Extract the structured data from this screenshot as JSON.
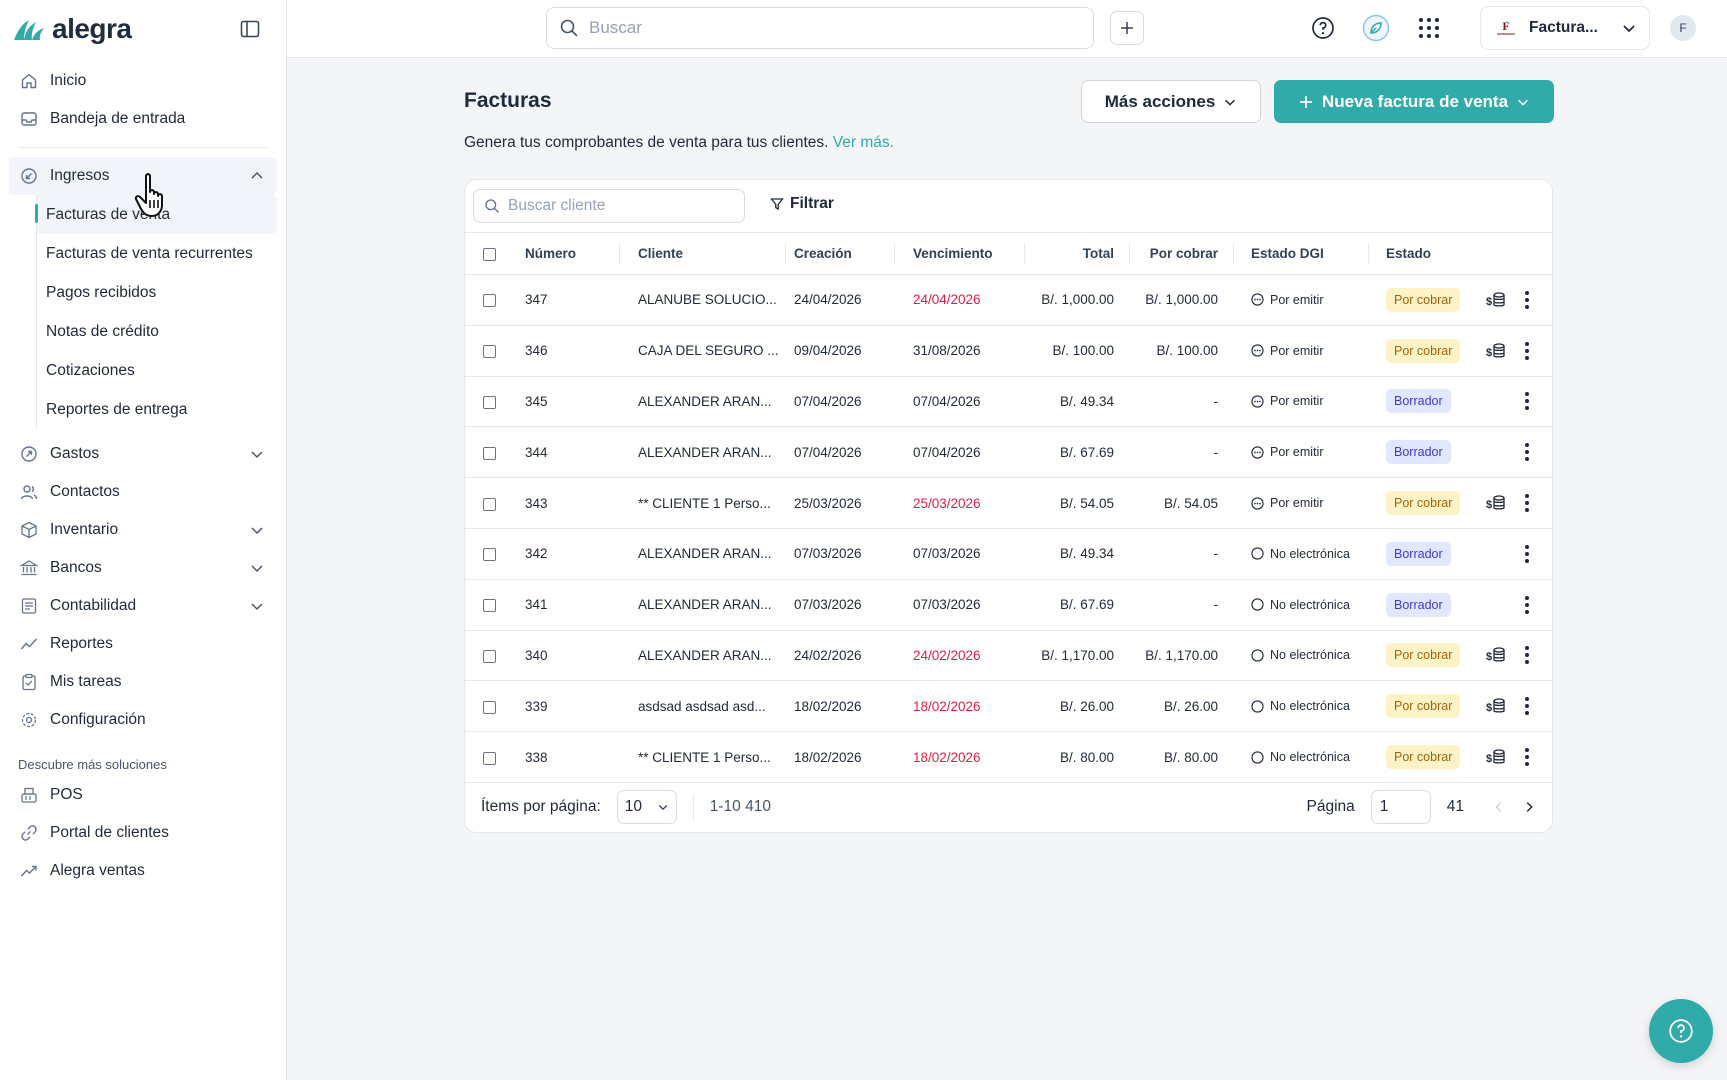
{
  "brand": {
    "name": "alegra",
    "accent": "#30aba9"
  },
  "sidebar": {
    "top_items": [
      {
        "label": "Inicio",
        "icon": "home-icon"
      },
      {
        "label": "Bandeja de entrada",
        "icon": "inbox-icon"
      }
    ],
    "ingresos": {
      "label": "Ingresos",
      "expanded": true,
      "items": [
        {
          "label": "Facturas de venta",
          "active": true
        },
        {
          "label": "Facturas de venta recurrentes"
        },
        {
          "label": "Pagos recibidos"
        },
        {
          "label": "Notas de crédito"
        },
        {
          "label": "Cotizaciones"
        },
        {
          "label": "Reportes de entrega"
        }
      ]
    },
    "main_items": [
      {
        "label": "Gastos",
        "icon": "expenses-icon",
        "expandable": true
      },
      {
        "label": "Contactos",
        "icon": "contacts-icon"
      },
      {
        "label": "Inventario",
        "icon": "inventory-icon",
        "expandable": true
      },
      {
        "label": "Bancos",
        "icon": "bank-icon",
        "expandable": true
      },
      {
        "label": "Contabilidad",
        "icon": "accounting-icon",
        "expandable": true
      },
      {
        "label": "Reportes",
        "icon": "reports-icon"
      },
      {
        "label": "Mis tareas",
        "icon": "tasks-icon"
      },
      {
        "label": "Configuración",
        "icon": "settings-icon"
      }
    ],
    "discover_label": "Descubre más soluciones",
    "discover_items": [
      {
        "label": "POS",
        "icon": "pos-icon"
      },
      {
        "label": "Portal de clientes",
        "icon": "portal-icon"
      },
      {
        "label": "Alegra ventas",
        "icon": "sales-icon"
      }
    ]
  },
  "topbar": {
    "search_placeholder": "Buscar",
    "company_label": "Factura...",
    "avatar_initial": "F"
  },
  "page": {
    "title": "Facturas",
    "description": "Genera tus comprobantes de venta para tus clientes.",
    "description_link": "Ver más.",
    "more_actions": "Más acciones",
    "new_invoice": "Nueva factura de venta"
  },
  "table": {
    "client_search_placeholder": "Buscar cliente",
    "filter_label": "Filtrar",
    "columns": [
      "Número",
      "Cliente",
      "Creación",
      "Vencimiento",
      "Total",
      "Por cobrar",
      "Estado DGI",
      "Estado"
    ],
    "rows": [
      {
        "numero": "347",
        "cliente": "ALANUBE SOLUCIO...",
        "creacion": "24/04/2026",
        "vencimiento": "24/04/2026",
        "overdue": true,
        "total": "B/. 1,000.00",
        "por_cobrar": "B/. 1,000.00",
        "dgi": "Por emitir",
        "dgi_type": "pending",
        "estado": "Por cobrar",
        "payable": true
      },
      {
        "numero": "346",
        "cliente": "CAJA DEL SEGURO ...",
        "creacion": "09/04/2026",
        "vencimiento": "31/08/2026",
        "overdue": false,
        "total": "B/. 100.00",
        "por_cobrar": "B/. 100.00",
        "dgi": "Por emitir",
        "dgi_type": "pending",
        "estado": "Por cobrar",
        "payable": true
      },
      {
        "numero": "345",
        "cliente": "ALEXANDER ARAN...",
        "creacion": "07/04/2026",
        "vencimiento": "07/04/2026",
        "overdue": false,
        "total": "B/. 49.34",
        "por_cobrar": "-",
        "dgi": "Por emitir",
        "dgi_type": "pending",
        "estado": "Borrador",
        "payable": false
      },
      {
        "numero": "344",
        "cliente": "ALEXANDER ARAN...",
        "creacion": "07/04/2026",
        "vencimiento": "07/04/2026",
        "overdue": false,
        "total": "B/. 67.69",
        "por_cobrar": "-",
        "dgi": "Por emitir",
        "dgi_type": "pending",
        "estado": "Borrador",
        "payable": false
      },
      {
        "numero": "343",
        "cliente": "** CLIENTE 1 Perso...",
        "creacion": "25/03/2026",
        "vencimiento": "25/03/2026",
        "overdue": true,
        "total": "B/. 54.05",
        "por_cobrar": "B/. 54.05",
        "dgi": "Por emitir",
        "dgi_type": "pending",
        "estado": "Por cobrar",
        "payable": true
      },
      {
        "numero": "342",
        "cliente": "ALEXANDER ARAN...",
        "creacion": "07/03/2026",
        "vencimiento": "07/03/2026",
        "overdue": false,
        "total": "B/. 49.34",
        "por_cobrar": "-",
        "dgi": "No electrónica",
        "dgi_type": "none",
        "estado": "Borrador",
        "payable": false
      },
      {
        "numero": "341",
        "cliente": "ALEXANDER ARAN...",
        "creacion": "07/03/2026",
        "vencimiento": "07/03/2026",
        "overdue": false,
        "total": "B/. 67.69",
        "por_cobrar": "-",
        "dgi": "No electrónica",
        "dgi_type": "none",
        "estado": "Borrador",
        "payable": false
      },
      {
        "numero": "340",
        "cliente": "ALEXANDER ARAN...",
        "creacion": "24/02/2026",
        "vencimiento": "24/02/2026",
        "overdue": true,
        "total": "B/. 1,170.00",
        "por_cobrar": "B/. 1,170.00",
        "dgi": "No electrónica",
        "dgi_type": "none",
        "estado": "Por cobrar",
        "payable": true
      },
      {
        "numero": "339",
        "cliente": "asdsad asdsad asd...",
        "creacion": "18/02/2026",
        "vencimiento": "18/02/2026",
        "overdue": true,
        "total": "B/. 26.00",
        "por_cobrar": "B/. 26.00",
        "dgi": "No electrónica",
        "dgi_type": "none",
        "estado": "Por cobrar",
        "payable": true
      },
      {
        "numero": "338",
        "cliente": "** CLIENTE 1 Perso...",
        "creacion": "18/02/2026",
        "vencimiento": "18/02/2026",
        "overdue": true,
        "total": "B/. 80.00",
        "por_cobrar": "B/. 80.00",
        "dgi": "No electrónica",
        "dgi_type": "none",
        "estado": "Por cobrar",
        "payable": true
      }
    ]
  },
  "pagination": {
    "items_per_page_label": "Ítems por página:",
    "items_per_page": "10",
    "range": "1-10 410",
    "page_label": "Página",
    "current_page": "1",
    "total_pages": "41"
  }
}
